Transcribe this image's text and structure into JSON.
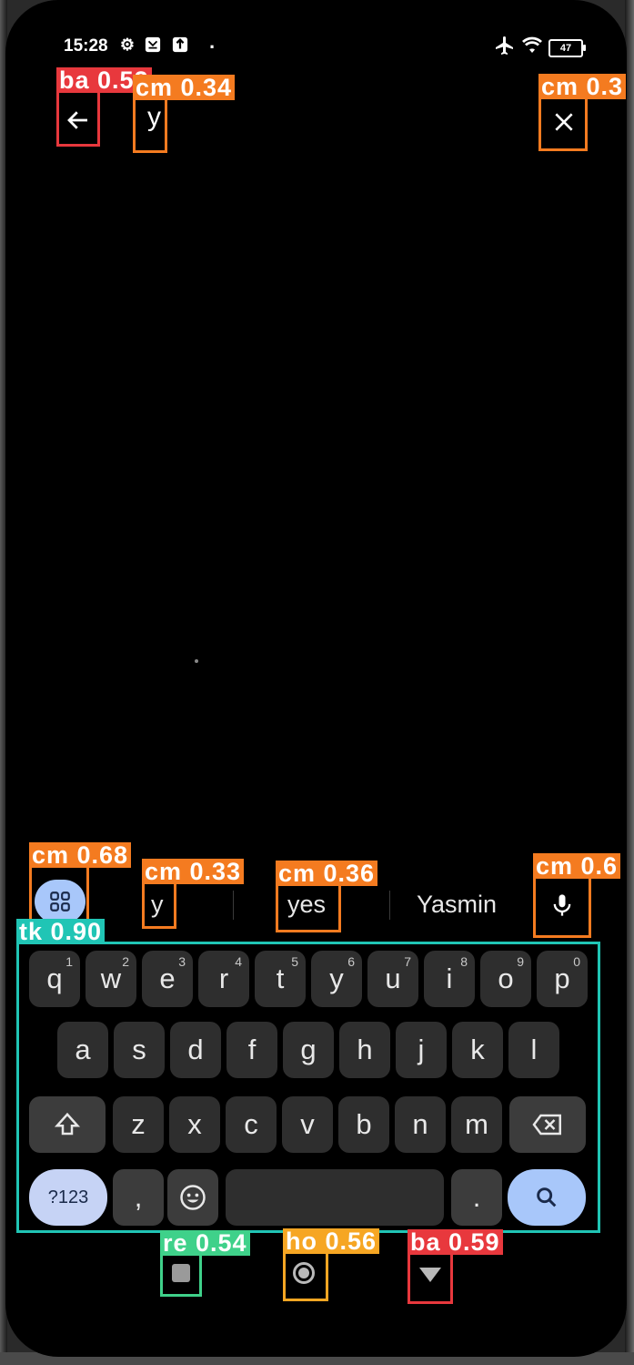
{
  "status_bar": {
    "time": "15:28",
    "battery": "47",
    "left_icons": [
      "gear-icon",
      "app-notif-icon",
      "upload-icon"
    ],
    "right_icons": [
      "airplane-icon",
      "wifi-icon",
      "battery-icon"
    ]
  },
  "search": {
    "query": "y",
    "back_icon": "back-arrow-icon",
    "clear_icon": "close-icon"
  },
  "suggestions": {
    "items": [
      "y",
      "yes",
      "Yasmin"
    ],
    "menu_icon": "apps-grid-icon",
    "mic_icon": "mic-icon"
  },
  "keyboard": {
    "row1": [
      {
        "k": "q",
        "n": "1"
      },
      {
        "k": "w",
        "n": "2"
      },
      {
        "k": "e",
        "n": "3"
      },
      {
        "k": "r",
        "n": "4"
      },
      {
        "k": "t",
        "n": "5"
      },
      {
        "k": "y",
        "n": "6"
      },
      {
        "k": "u",
        "n": "7"
      },
      {
        "k": "i",
        "n": "8"
      },
      {
        "k": "o",
        "n": "9"
      },
      {
        "k": "p",
        "n": "0"
      }
    ],
    "row2": [
      "a",
      "s",
      "d",
      "f",
      "g",
      "h",
      "j",
      "k",
      "l"
    ],
    "row3": [
      "z",
      "x",
      "c",
      "v",
      "b",
      "n",
      "m"
    ],
    "symbols_label": "?123",
    "comma_label": ",",
    "period_label": ".",
    "shift_icon": "shift-icon",
    "backspace_icon": "backspace-icon",
    "emoji_icon": "emoji-icon",
    "enter_icon": "search-icon"
  },
  "navigation": {
    "recents_icon": "recents-icon",
    "home_icon": "home-icon",
    "back_icon": "back-triangle-icon"
  },
  "detections": [
    {
      "label": "ba 0.52"
    },
    {
      "label": "cm 0.34"
    },
    {
      "label": "cm 0.3"
    },
    {
      "label": "cm 0.68"
    },
    {
      "label": "cm 0.33"
    },
    {
      "label": "cm 0.36"
    },
    {
      "label": "cm 0.6"
    },
    {
      "label": "tk 0.90"
    },
    {
      "label": "re 0.54"
    },
    {
      "label": "ho 0.56"
    },
    {
      "label": "ba 0.59"
    }
  ],
  "colors": {
    "ba": "#e8383d",
    "cm": "#f47b20",
    "tk": "#20c5b5",
    "re": "#3fd18a",
    "ho": "#f6a623",
    "accent": "#a8c7fa"
  }
}
